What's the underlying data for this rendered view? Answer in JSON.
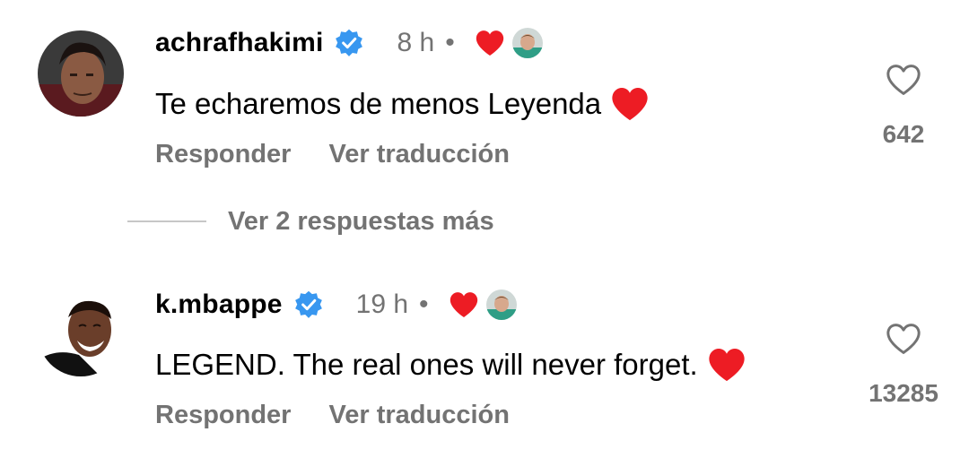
{
  "comments": [
    {
      "username": "achrafhakimi",
      "verified": true,
      "time": "8 h",
      "separator": "•",
      "text": "Te echaremos de menos Leyenda",
      "text_emoji": "red-heart",
      "actions": {
        "reply": "Responder",
        "translate": "Ver traducción"
      },
      "likes": "642",
      "liked_by_author": true
    },
    {
      "username": "k.mbappe",
      "verified": true,
      "time": "19 h",
      "separator": "•",
      "text": "LEGEND. The real ones will never forget.",
      "text_emoji": "red-heart",
      "actions": {
        "reply": "Responder",
        "translate": "Ver traducción"
      },
      "likes": "13285",
      "liked_by_author": true
    }
  ],
  "replies": {
    "label": "Ver 2 respuestas más"
  },
  "colors": {
    "verified_badge": "#3897f0",
    "heart_red": "#ed1c24",
    "secondary_text": "#737373",
    "primary_text": "#000000"
  },
  "icons": {
    "verified": "verified-badge-icon",
    "like": "heart-outline-icon",
    "liked": "red-heart-icon"
  }
}
